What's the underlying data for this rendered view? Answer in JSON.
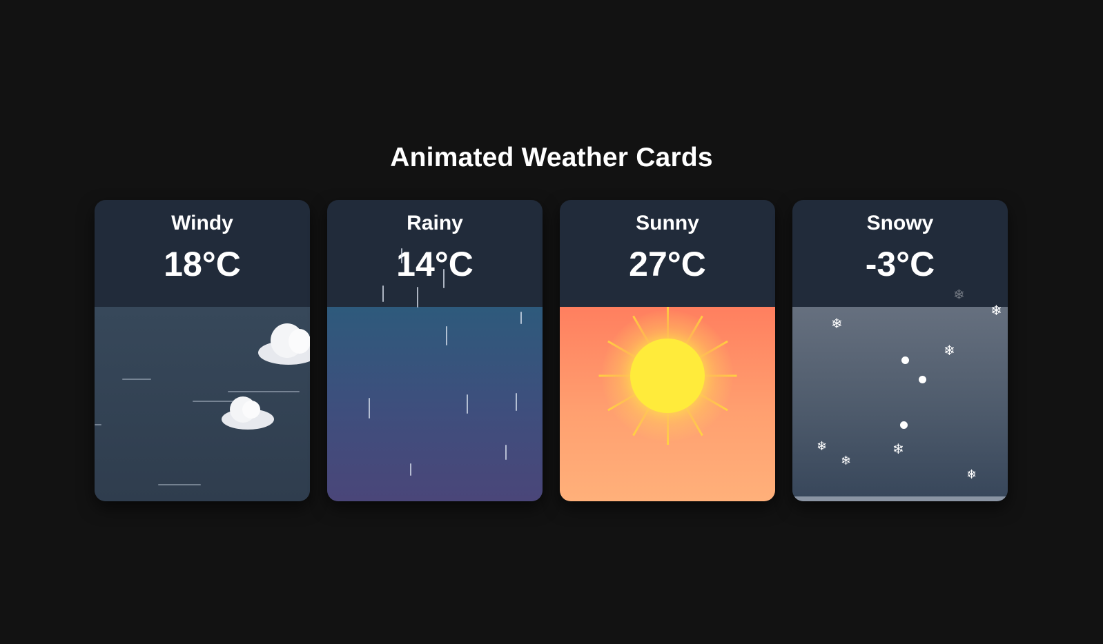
{
  "page": {
    "title": "Animated Weather Cards",
    "background_color": "#121212"
  },
  "cards": [
    {
      "name": "Windy",
      "temperature": "18°C",
      "scene": "wind gusts and clouds",
      "icons": [
        "cloud-icon",
        "cloud-icon"
      ]
    },
    {
      "name": "Rainy",
      "temperature": "14°C",
      "scene": "falling raindrops",
      "icons": []
    },
    {
      "name": "Sunny",
      "temperature": "27°C",
      "scene": "sun with rays",
      "icons": [
        "sun-icon"
      ]
    },
    {
      "name": "Snowy",
      "temperature": "-3°C",
      "scene": "falling snowflakes",
      "icons": [
        "snowflake-icon"
      ]
    }
  ],
  "colors": {
    "card_header": "#212b3a",
    "sun": "#ffeb3b",
    "sunny_sky": "#ff7f5f",
    "rainy_sky": "#2e5a7c",
    "snowy_sky": "#66707f",
    "windy_sky": "#37485a"
  }
}
